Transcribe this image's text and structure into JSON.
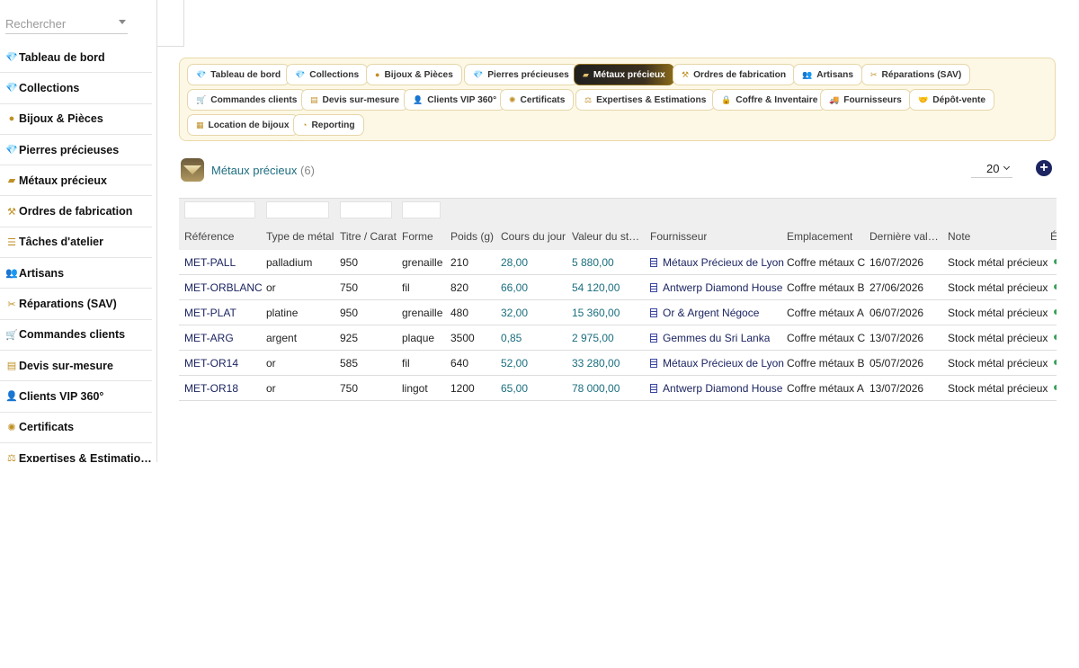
{
  "search": {
    "placeholder": "Rechercher"
  },
  "sidebar": {
    "items": [
      {
        "label": "Tableau de bord",
        "icon": "diamond-icon"
      },
      {
        "label": "Collections",
        "icon": "diamond-icon"
      },
      {
        "label": "Bijoux & Pièces",
        "icon": "coin-icon"
      },
      {
        "label": "Pierres précieuses",
        "icon": "diamond-icon"
      },
      {
        "label": "Métaux précieux",
        "icon": "ingot-icon"
      },
      {
        "label": "Ordres de fabrication",
        "icon": "hammer-icon"
      },
      {
        "label": "Tâches d'atelier",
        "icon": "list-icon"
      },
      {
        "label": "Artisans",
        "icon": "users-icon"
      },
      {
        "label": "Réparations (SAV)",
        "icon": "tools-icon"
      },
      {
        "label": "Commandes clients",
        "icon": "cart-icon"
      },
      {
        "label": "Devis sur-mesure",
        "icon": "document-icon"
      },
      {
        "label": "Clients VIP 360°",
        "icon": "user-icon"
      },
      {
        "label": "Certificats",
        "icon": "certificate-icon"
      },
      {
        "label": "Expertises & Estimations",
        "icon": "scale-icon"
      }
    ]
  },
  "tabs": [
    {
      "label": "Tableau de bord",
      "icon": "diamond-icon"
    },
    {
      "label": "Collections",
      "icon": "diamond-icon"
    },
    {
      "label": "Bijoux & Pièces",
      "icon": "coin-icon"
    },
    {
      "label": "Pierres précieuses",
      "icon": "diamond-icon"
    },
    {
      "label": "Métaux précieux",
      "icon": "ingot-icon",
      "active": true
    },
    {
      "label": "Ordres de fabrication",
      "icon": "hammer-icon"
    },
    {
      "label": "Artisans",
      "icon": "users-icon"
    },
    {
      "label": "Réparations (SAV)",
      "icon": "tools-icon"
    },
    {
      "label": "Commandes clients",
      "icon": "cart-icon"
    },
    {
      "label": "Devis sur-mesure",
      "icon": "document-icon"
    },
    {
      "label": "Clients VIP 360°",
      "icon": "user-icon"
    },
    {
      "label": "Certificats",
      "icon": "certificate-icon"
    },
    {
      "label": "Expertises & Estimations",
      "icon": "scale-icon"
    },
    {
      "label": "Coffre & Inventaire",
      "icon": "lock-icon"
    },
    {
      "label": "Fournisseurs",
      "icon": "truck-icon"
    },
    {
      "label": "Dépôt-vente",
      "icon": "handshake-icon"
    },
    {
      "label": "Location de bijoux",
      "icon": "calendar-icon"
    },
    {
      "label": "Reporting",
      "icon": "pie-chart-icon"
    }
  ],
  "page": {
    "title": "Métaux précieux",
    "count": "(6)",
    "page_size": "20"
  },
  "table": {
    "headers": [
      "Référence",
      "Type de métal",
      "Titre / Carat",
      "Forme",
      "Poids (g)",
      "Cours du jour",
      "Valeur du st…",
      "Fournisseur",
      "Emplacement",
      "Dernière val…",
      "Note",
      "É"
    ],
    "rows": [
      [
        "MET-PALL",
        "palladium",
        "950",
        "grenaille",
        "210",
        "28,00",
        "5 880,00",
        "Métaux Précieux de Lyon",
        "Coffre métaux C",
        "16/07/2026",
        "Stock métal précieux"
      ],
      [
        "MET-ORBLANC",
        "or",
        "750",
        "fil",
        "820",
        "66,00",
        "54 120,00",
        "Antwerp Diamond House",
        "Coffre métaux B",
        "27/06/2026",
        "Stock métal précieux"
      ],
      [
        "MET-PLAT",
        "platine",
        "950",
        "grenaille",
        "480",
        "32,00",
        "15 360,00",
        "Or & Argent Négoce",
        "Coffre métaux A",
        "06/07/2026",
        "Stock métal précieux"
      ],
      [
        "MET-ARG",
        "argent",
        "925",
        "plaque",
        "3500",
        "0,85",
        "2 975,00",
        "Gemmes du Sri Lanka",
        "Coffre métaux C",
        "13/07/2026",
        "Stock métal précieux"
      ],
      [
        "MET-OR14",
        "or",
        "585",
        "fil",
        "640",
        "52,00",
        "33 280,00",
        "Métaux Précieux de Lyon",
        "Coffre métaux B",
        "05/07/2026",
        "Stock métal précieux"
      ],
      [
        "MET-OR18",
        "or",
        "750",
        "lingot",
        "1200",
        "65,00",
        "78 000,00",
        "Antwerp Diamond House",
        "Coffre métaux A",
        "13/07/2026",
        "Stock métal précieux"
      ]
    ]
  },
  "colors": {
    "accent_gold": "#c09026",
    "link_navy": "#1c2561",
    "teal": "#1a6e7e",
    "status_green": "#3aa05a"
  }
}
